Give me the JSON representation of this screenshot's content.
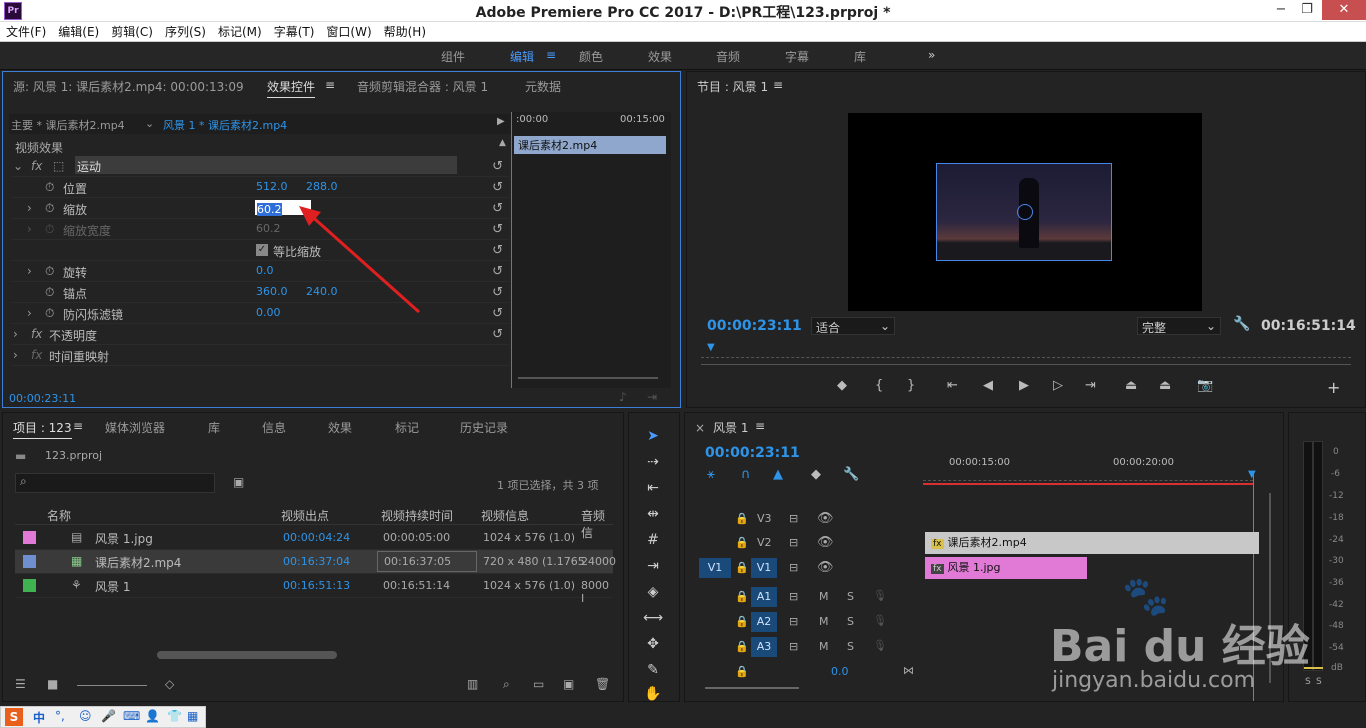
{
  "window": {
    "title": "Adobe Premiere Pro CC 2017 - D:\\PR工程\\123.prproj *",
    "app_icon": "Pr",
    "minimize": "−",
    "restore": "❐",
    "close": "✕"
  },
  "menu": [
    "文件(F)",
    "编辑(E)",
    "剪辑(C)",
    "序列(S)",
    "标记(M)",
    "字幕(T)",
    "窗口(W)",
    "帮助(H)"
  ],
  "workspaces": {
    "items": [
      "组件",
      "编辑",
      "颜色",
      "效果",
      "音频",
      "字幕",
      "库"
    ],
    "active": "编辑",
    "more": "»"
  },
  "source_panel": {
    "tabs": [
      "源: 风景 1: 课后素材2.mp4: 00:00:13:09",
      "效果控件",
      "音频剪辑混合器 : 风景 1",
      "元数据"
    ],
    "master": "主要 * 课后素材2.mp4",
    "sequence_clip": "风景 1 * 课后素材2.mp4",
    "ruler_start": ":00:00",
    "ruler_end": "00:15:00",
    "clip_bar": "课后素材2.mp4",
    "section": "视频效果",
    "rows": {
      "motion": "运动",
      "position": "位置",
      "position_x": "512.0",
      "position_y": "288.0",
      "scale": "缩放",
      "scale_value": "60.2",
      "scale_width": "缩放宽度",
      "scale_width_value": "60.2",
      "uniform": "等比缩放",
      "rotation": "旋转",
      "rotation_value": "0.0",
      "anchor": "锚点",
      "anchor_x": "360.0",
      "anchor_y": "240.0",
      "antiflicker": "防闪烁滤镜",
      "antiflicker_value": "0.00",
      "opacity": "不透明度",
      "timeremap": "时间重映射"
    },
    "timecode": "00:00:23:11"
  },
  "program_panel": {
    "title": "节目 : 风景 1",
    "timecode": "00:00:23:11",
    "fit": "适合",
    "quality": "完整",
    "duration": "00:16:51:14"
  },
  "project_panel": {
    "tabs": [
      "项目 : 123",
      "媒体浏览器",
      "库",
      "信息",
      "效果",
      "标记",
      "历史记录"
    ],
    "file": "123.prproj",
    "selection": "1 项已选择，共 3 项",
    "columns": [
      "名称",
      "视频出点",
      "视频持续时间",
      "视频信息",
      "音频信"
    ],
    "rows": [
      {
        "color": "#e07ad6",
        "name": "风景 1.jpg",
        "out": "00:00:04:24",
        "dur": "00:00:05:00",
        "info": "1024 x 576 (1.0)",
        "audio": ""
      },
      {
        "color": "#6f8fd0",
        "name": "课后素材2.mp4",
        "out": "00:16:37:04",
        "dur": "00:16:37:05",
        "info": "720 x 480 (1.1765",
        "audio": "24000"
      },
      {
        "color": "#3fb34f",
        "name": "风景 1",
        "out": "00:16:51:13",
        "dur": "00:16:51:14",
        "info": "1024 x 576 (1.0)",
        "audio": "8000 I"
      }
    ]
  },
  "timeline": {
    "tab": "风景 1",
    "timecode": "00:00:23:11",
    "ruler": [
      "00:00:15:00",
      "00:00:20:00"
    ],
    "tracks_video": [
      "V3",
      "V2",
      "V1"
    ],
    "tracks_audio": [
      "A1",
      "A2",
      "A3"
    ],
    "source_patch": "V1",
    "clip_v2": "课后素材2.mp4",
    "clip_v1": "风景 1.jpg",
    "master_vol": "0.0"
  },
  "meter": {
    "labels": [
      "0",
      "-6",
      "-12",
      "-18",
      "-24",
      "-30",
      "-36",
      "-42",
      "-48",
      "-54",
      "dB"
    ],
    "solo": [
      "S",
      "S"
    ]
  },
  "watermark": {
    "brand": "Bai du 经验",
    "url": "jingyan.baidu.com"
  },
  "ime": {
    "items": [
      "S",
      "中",
      "°,",
      "☺",
      "🎤",
      "⌨",
      "👤",
      "👕",
      "▦"
    ]
  }
}
